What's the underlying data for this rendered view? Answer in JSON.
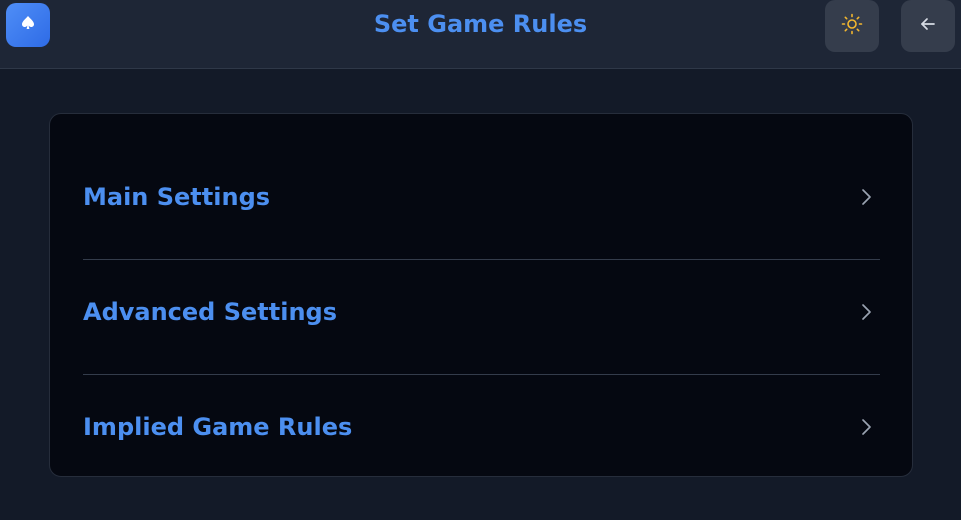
{
  "header": {
    "title": "Set Game Rules",
    "logo_icon": "spade-icon",
    "theme_icon": "sun-icon",
    "back_icon": "arrow-left-icon"
  },
  "menu": {
    "items": [
      {
        "label": "Main Settings",
        "icon": "chevron-right-icon"
      },
      {
        "label": "Advanced Settings",
        "icon": "chevron-right-icon"
      },
      {
        "label": "Implied Game Rules",
        "icon": "chevron-right-icon"
      }
    ]
  },
  "colors": {
    "accent": "#4c8ff0",
    "background": "#131a28",
    "header": "#1e2636",
    "card": "#050811",
    "sun": "#f5b82e"
  }
}
